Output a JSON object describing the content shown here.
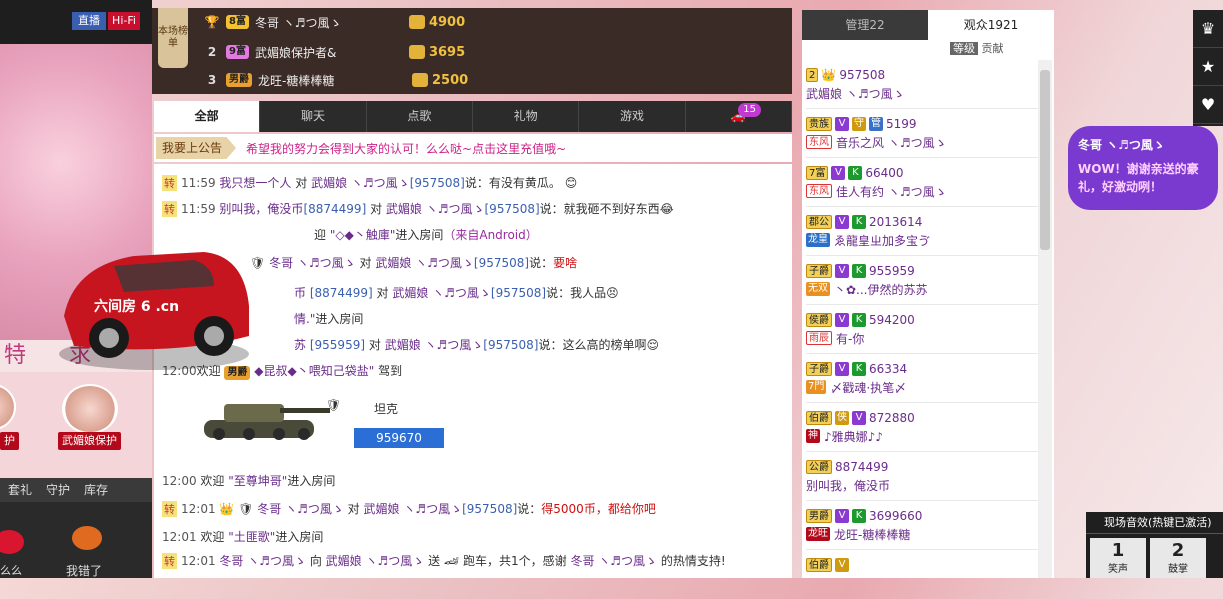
{
  "left": {
    "live": "直播",
    "hifi": "Hi-Fi",
    "banner": "特 求",
    "guard_label_1": "护",
    "guard_label_2": "武媚娘保护",
    "tabs": [
      "套礼",
      "守护",
      "库存"
    ],
    "bottom_left": "么么",
    "bottom_right": "我错了"
  },
  "rank": {
    "badge": "本场榜单",
    "rows": [
      {
        "num": "",
        "lvl": "8富",
        "name": "冬哥 ヽ♬つ風ゝ",
        "amount": "4900"
      },
      {
        "num": "2",
        "lvl": "9富",
        "name": "武媚娘保护者&",
        "amount": "3695"
      },
      {
        "num": "3",
        "lvl": "男爵",
        "name": "龙旺-糖棒棒糖",
        "amount": "2500"
      }
    ]
  },
  "chat_tabs": {
    "items": [
      "全部",
      "聊天",
      "点歌",
      "礼物",
      "游戏",
      ""
    ],
    "badge": "15"
  },
  "notice": {
    "tag": "我要上公告",
    "text": "希望我的努力会得到大家的认可！么么哒~点击这里充值哦~"
  },
  "chat": {
    "m1": {
      "z": "转",
      "t": "11:59",
      "a": "我只想一个人",
      "b": "对",
      "c": "武媚娘 ヽ♬つ風ゝ",
      "d": "[957508]",
      "e": "说：有没有黄瓜。"
    },
    "m2": {
      "z": "转",
      "t": "11:59",
      "a": "别叫我，俺没币",
      "d1": "[8874499]",
      "b": "对",
      "c": "武媚娘 ヽ♬つ風ゝ",
      "d": "[957508]",
      "e": "说：就我砸不到好东西"
    },
    "m3": {
      "t": "迎",
      "a": "\"◇◆丶触庫\"",
      "b": "进入房间",
      "c": "（来自Android）"
    },
    "m4": {
      "a": "冬哥 ヽ♬つ風ゝ",
      "b": "对",
      "c": "武媚娘 ヽ♬つ風ゝ",
      "d": "[957508]",
      "e": "说：",
      "f": "要啥"
    },
    "m5": {
      "a": "币",
      "d1": "[8874499]",
      "b": "对",
      "c": "武媚娘 ヽ♬つ風ゝ",
      "d": "[957508]",
      "e": "说：我人品"
    },
    "m6": {
      "a": "情.\"",
      "b": "进入房间"
    },
    "m7": {
      "a": "苏",
      "d1": "[955959]",
      "b": "对",
      "c": "武媚娘 ヽ♬つ風ゝ",
      "d": "[957508]",
      "e": "说：这么高的榜单啊"
    },
    "m8": {
      "t": "12:00",
      "w": "欢迎",
      "lvl": "男爵",
      "a": "◆昆叔◆丶喂知己袋盐\"",
      "b": "驾到"
    },
    "tank": {
      "label": "坦克",
      "num": "959670"
    },
    "m9": {
      "t": "12:00",
      "w": "欢迎",
      "a": "\"至尊坤哥\"",
      "b": "进入房间"
    },
    "m10": {
      "z": "转",
      "t": "12:01",
      "a": "冬哥 ヽ♬つ風ゝ",
      "b": "对",
      "c": "武媚娘 ヽ♬つ風ゝ",
      "d": "[957508]",
      "e": "说：",
      "f": "得5000币，都给你吧"
    },
    "m11": {
      "t": "12:01",
      "w": "欢迎",
      "a": "\"土匪歌\"",
      "b": "进入房间"
    },
    "m12": {
      "z": "转",
      "t": "12:01",
      "a": "冬哥 ヽ♬つ風ゝ",
      "b": "向",
      "c": "武媚娘 ヽ♬つ風ゝ",
      "s": "送",
      "g": "跑车，共1个，感谢",
      "n": "冬哥 ヽ♬つ風ゝ",
      "e": "的热情支持!"
    },
    "car_text": "六间房 6 .cn"
  },
  "right": {
    "tabs": [
      "管理22",
      "观众1921"
    ],
    "sort": [
      "等级",
      "贡献"
    ],
    "users": [
      {
        "lvl": "2",
        "num": "957508",
        "name": "武媚娘 ヽ♬つ風ゝ",
        "tag": ""
      },
      {
        "lvl": "贵族",
        "num": "5199",
        "name": "音乐之风 ヽ♬つ風ゝ",
        "tag": "东风"
      },
      {
        "lvl": "7富",
        "num": "66400",
        "name": "佳人有约 ヽ♬つ風ゝ",
        "tag": "东风"
      },
      {
        "lvl": "郡公",
        "num": "2013614",
        "name": "ゑ龍皇ㄓ加多宝ゔ",
        "tag": "龙皇"
      },
      {
        "lvl": "子爵",
        "num": "955959",
        "name": "丶✿...伊然的苏苏",
        "tag": "无双"
      },
      {
        "lvl": "侯爵",
        "num": "594200",
        "name": "有-你",
        "tag": "雨辰"
      },
      {
        "lvl": "子爵",
        "num": "66334",
        "name": "〆戳魂·执笔〆",
        "tag": "7門"
      },
      {
        "lvl": "伯爵",
        "num": "872880",
        "name": "♪雅典娜♪♪",
        "tag": "神"
      },
      {
        "lvl": "公爵",
        "num": "8874499",
        "name": "别叫我，俺没币",
        "tag": ""
      },
      {
        "lvl": "男爵",
        "num": "3699660",
        "name": "龙旺-糖棒棒糖",
        "tag": "龙旺"
      },
      {
        "lvl": "伯爵",
        "num": "",
        "name": "",
        "tag": ""
      }
    ]
  },
  "bubble": {
    "who": "冬哥 ヽ♬つ風ゝ",
    "text": "WOW！谢谢亲送的豪礼，好激动咧！"
  },
  "fx": {
    "title": "现场音效(热键已激活)",
    "b1": "1",
    "b2": "2",
    "s1": "笑声",
    "s2": "鼓掌"
  },
  "colors": {
    "accent": "#c03ad0",
    "rank_bg": "#3b2b26",
    "blue": "#2b6fd6"
  }
}
